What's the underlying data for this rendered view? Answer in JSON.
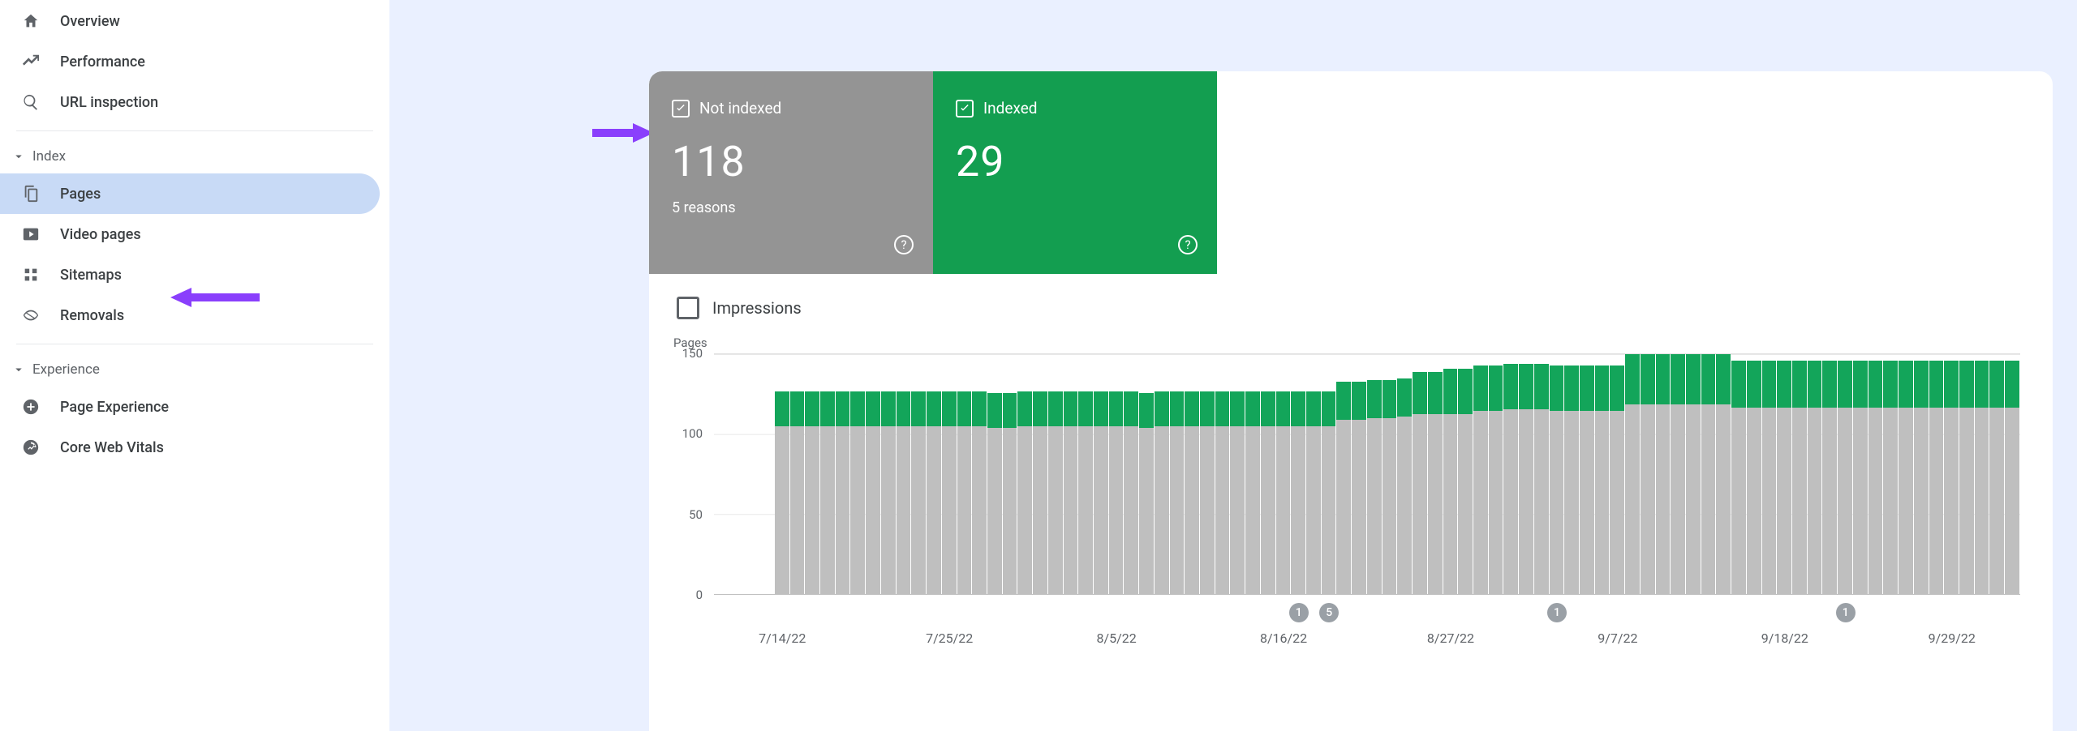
{
  "sidebar": {
    "top_items": [
      {
        "icon": "home",
        "label": "Overview"
      },
      {
        "icon": "performance",
        "label": "Performance"
      },
      {
        "icon": "search",
        "label": "URL inspection"
      }
    ],
    "index_section": {
      "title": "Index",
      "items": [
        {
          "icon": "pages",
          "label": "Pages",
          "active": true
        },
        {
          "icon": "video",
          "label": "Video pages"
        },
        {
          "icon": "sitemap",
          "label": "Sitemaps"
        },
        {
          "icon": "removals",
          "label": "Removals"
        }
      ]
    },
    "experience_section": {
      "title": "Experience",
      "items": [
        {
          "icon": "pageexp",
          "label": "Page Experience"
        },
        {
          "icon": "cwv",
          "label": "Core Web Vitals"
        }
      ]
    }
  },
  "cards": {
    "not_indexed": {
      "title": "Not indexed",
      "value": "118",
      "sub": "5 reasons"
    },
    "indexed": {
      "title": "Indexed",
      "value": "29"
    }
  },
  "impressions_label": "Impressions",
  "chart_data": {
    "type": "bar",
    "title": "Pages",
    "ylabel": "Pages",
    "ylim": [
      0,
      150
    ],
    "y_ticks": [
      0,
      50,
      100,
      150
    ],
    "x_ticks": [
      {
        "pos": 4,
        "label": "7/14/22"
      },
      {
        "pos": 15,
        "label": "7/25/22"
      },
      {
        "pos": 26,
        "label": "8/5/22"
      },
      {
        "pos": 37,
        "label": "8/16/22"
      },
      {
        "pos": 48,
        "label": "8/27/22"
      },
      {
        "pos": 59,
        "label": "9/7/22"
      },
      {
        "pos": 70,
        "label": "9/18/22"
      },
      {
        "pos": 81,
        "label": "9/29/22"
      }
    ],
    "empty_leading": 4,
    "series": [
      {
        "name": "Not indexed",
        "color": "#bfbfbf",
        "values": [
          104,
          104,
          104,
          104,
          104,
          104,
          104,
          104,
          104,
          104,
          104,
          104,
          104,
          104,
          103,
          103,
          104,
          104,
          104,
          104,
          104,
          104,
          104,
          104,
          103,
          104,
          104,
          104,
          104,
          104,
          104,
          104,
          104,
          104,
          104,
          104,
          104,
          108,
          108,
          109,
          109,
          110,
          112,
          112,
          112,
          112,
          114,
          114,
          115,
          115,
          115,
          114,
          114,
          114,
          114,
          114,
          118,
          118,
          118,
          118,
          118,
          118,
          118,
          116,
          116,
          116,
          116,
          116,
          116,
          116,
          116,
          116,
          116,
          116,
          116,
          116,
          116,
          116,
          116,
          116,
          116,
          116
        ]
      },
      {
        "name": "Indexed",
        "color": "#13a55a",
        "values": [
          22,
          22,
          22,
          22,
          22,
          22,
          22,
          22,
          22,
          22,
          22,
          22,
          22,
          22,
          22,
          22,
          22,
          22,
          22,
          22,
          22,
          22,
          22,
          22,
          22,
          22,
          22,
          22,
          22,
          22,
          22,
          22,
          22,
          22,
          22,
          22,
          22,
          24,
          24,
          24,
          24,
          24,
          26,
          26,
          28,
          28,
          28,
          28,
          28,
          28,
          28,
          28,
          28,
          28,
          28,
          28,
          31,
          31,
          31,
          31,
          31,
          31,
          31,
          29,
          29,
          29,
          29,
          29,
          29,
          29,
          29,
          29,
          29,
          29,
          29,
          29,
          29,
          29,
          29,
          29,
          29,
          29
        ]
      }
    ],
    "bubbles": [
      {
        "pos": 38,
        "label": "1"
      },
      {
        "pos": 40,
        "label": "5"
      },
      {
        "pos": 55,
        "label": "1"
      },
      {
        "pos": 74,
        "label": "1"
      }
    ]
  }
}
